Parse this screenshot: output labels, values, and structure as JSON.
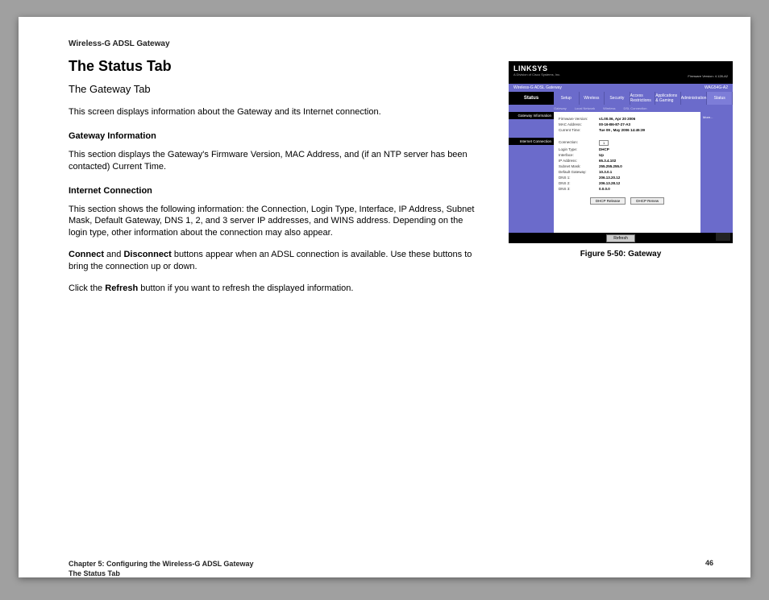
{
  "doc_header": "Wireless-G ADSL Gateway",
  "title": "The Status Tab",
  "subtitle": "The Gateway Tab",
  "intro": "This screen displays information about the Gateway and its Internet connection.",
  "sec1_h": "Gateway Information",
  "sec1_p": "This section displays the Gateway's Firmware Version, MAC Address, and (if an NTP server has been contacted) Current Time.",
  "sec2_h": "Internet Connection",
  "sec2_p": "This section shows the following information: the Connection, Login Type, Interface, IP Address, Subnet Mask, Default Gateway, DNS 1, 2, and 3 server IP addresses, and WINS address. Depending on the login type, other information about the connection may also appear.",
  "para3_a": "Connect",
  "para3_mid": " and ",
  "para3_b": "Disconnect",
  "para3_c": " buttons appear when an ADSL connection is available. Use these buttons to bring the connection up or down.",
  "para4_a": "Click the ",
  "para4_b": "Refresh",
  "para4_c": " button if you want to refresh the displayed information.",
  "caption": "Figure 5-50: Gateway",
  "footer_line1": "Chapter 5: Configuring the Wireless-G ADSL Gateway",
  "footer_line2": "The Status Tab",
  "page_num": "46",
  "fig": {
    "brand": "LINKSYS",
    "brand_sub": "A Division of Cisco Systems, Inc.",
    "fw": "Firmware Version: 4.128-A2",
    "model_title": "Wireless-G ADSL Gateway",
    "model": "WAG54G-A2",
    "side": "Status",
    "tabs": [
      "Setup",
      "Wireless",
      "Security",
      "Access Restrictions",
      "Applications & Gaming",
      "Administration",
      "Status"
    ],
    "subtabs": [
      "Gateway",
      "Local Network",
      "Wireless",
      "DSL Connection"
    ],
    "box1": "Gateway Information",
    "box2": "Internet Connection",
    "rows1": [
      {
        "k": "Firmware Version:",
        "v": "v1.00.06, Apr 20 2006"
      },
      {
        "k": "MAC Address:",
        "v": "00-16-B6-87-27-A3"
      },
      {
        "k": "Current Time:",
        "v": "Tue 09 , May 2006 14:45:39"
      }
    ],
    "rows2": [
      {
        "k": "Connection:",
        "v": ""
      },
      {
        "k": "Login Type:",
        "v": "DHCP"
      },
      {
        "k": "Interface:",
        "v": "Up"
      },
      {
        "k": "IP Address:",
        "v": "65.3.4.102"
      },
      {
        "k": "Subnet Mask:",
        "v": "255.255.255.0"
      },
      {
        "k": "Default Gateway:",
        "v": "10.3.0.1"
      },
      {
        "k": "DNS 1:",
        "v": "206.13.20.12"
      },
      {
        "k": "DNS 2:",
        "v": "206.13.28.12"
      },
      {
        "k": "DNS 3:",
        "v": "0.0.0.0"
      }
    ],
    "sel": "1",
    "btn1": "DHCP Release",
    "btn2": "DHCP Renew",
    "refresh": "Refresh",
    "more": "More..."
  }
}
